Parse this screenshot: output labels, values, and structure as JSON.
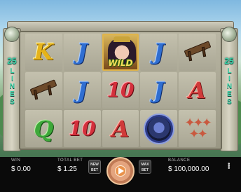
{
  "game": {
    "paylines": "25",
    "lines_word": "LINES"
  },
  "reels": [
    [
      "K",
      "bench",
      "Q"
    ],
    [
      "J",
      "J",
      "10"
    ],
    [
      "WILD",
      "10",
      "A"
    ],
    [
      "J",
      "J",
      "demon"
    ],
    [
      "bench",
      "A",
      "figures"
    ]
  ],
  "wild_label": "WILD",
  "hud": {
    "win_label": "WIN",
    "win_value": "$ 0.00",
    "bet_label": "TOTAL BET",
    "bet_value": "$ 1.25",
    "newbet_line1": "NEW",
    "newbet_line2": "BET",
    "maxbet_line1": "MAX",
    "maxbet_line2": "BET",
    "balance_label": "BALANCE",
    "balance_value": "$ 100,000.00"
  },
  "icons": {
    "spin": "play-icon",
    "menu": "more-vertical-icon"
  },
  "colors": {
    "lines_text": "#3ad0a6",
    "wild_text": "#f5e05a",
    "spin_accent": "#e9924b"
  }
}
